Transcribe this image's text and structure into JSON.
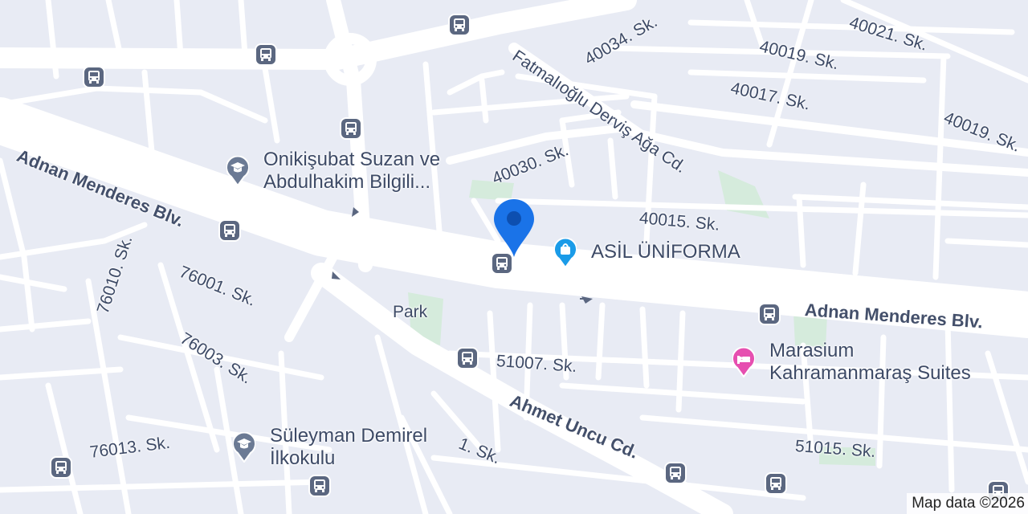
{
  "map": {
    "streets": {
      "adnan_menderes_w": "Adnan Menderes Blv.",
      "adnan_menderes_e": "Adnan Menderes Blv.",
      "fatmalioglu": "Fatmalıoğlu Derviş Ağa Cd.",
      "ahmet_uncu": "Ahmet Uncu Cd.",
      "s40034": "40034. Sk.",
      "s40021": "40021. Sk.",
      "s40019a": "40019. Sk.",
      "s40019b": "40019. Sk.",
      "s40017": "40017. Sk.",
      "s40030": "40030. Sk.",
      "s40015": "40015. Sk.",
      "s76010": "76010. Sk.",
      "s76001": "76001. Sk.",
      "s76003": "76003. Sk.",
      "s76013": "76013. Sk.",
      "s51007": "51007. Sk.",
      "s51015": "51015. Sk.",
      "s1": "1. Sk.",
      "park": "Park"
    },
    "pois": {
      "school1_line1": "Onikişubat Suzan ve",
      "school1_line2": "Abdulhakim Bilgili...",
      "shop": "ASİL ÜNİFORMA",
      "hotel_line1": "Marasium",
      "hotel_line2": "Kahramanmaraş Suites",
      "school2_line1": "Süleyman Demirel",
      "school2_line2": "İlkokulu"
    },
    "icons": {
      "bus": "bus-stop-icon",
      "school": "school-icon",
      "shop": "shopping-bag-icon",
      "hotel": "hotel-bed-icon",
      "marker": "location-pin-icon"
    },
    "colors": {
      "background": "#e8ebf4",
      "road": "#ffffff",
      "park": "#d5ebdc",
      "school_pin": "#6b7a94",
      "shop_pin": "#1a9be8",
      "hotel_pin": "#e64fb0",
      "marker": "#1a73e8"
    },
    "attribution": "Map data ©2026"
  }
}
